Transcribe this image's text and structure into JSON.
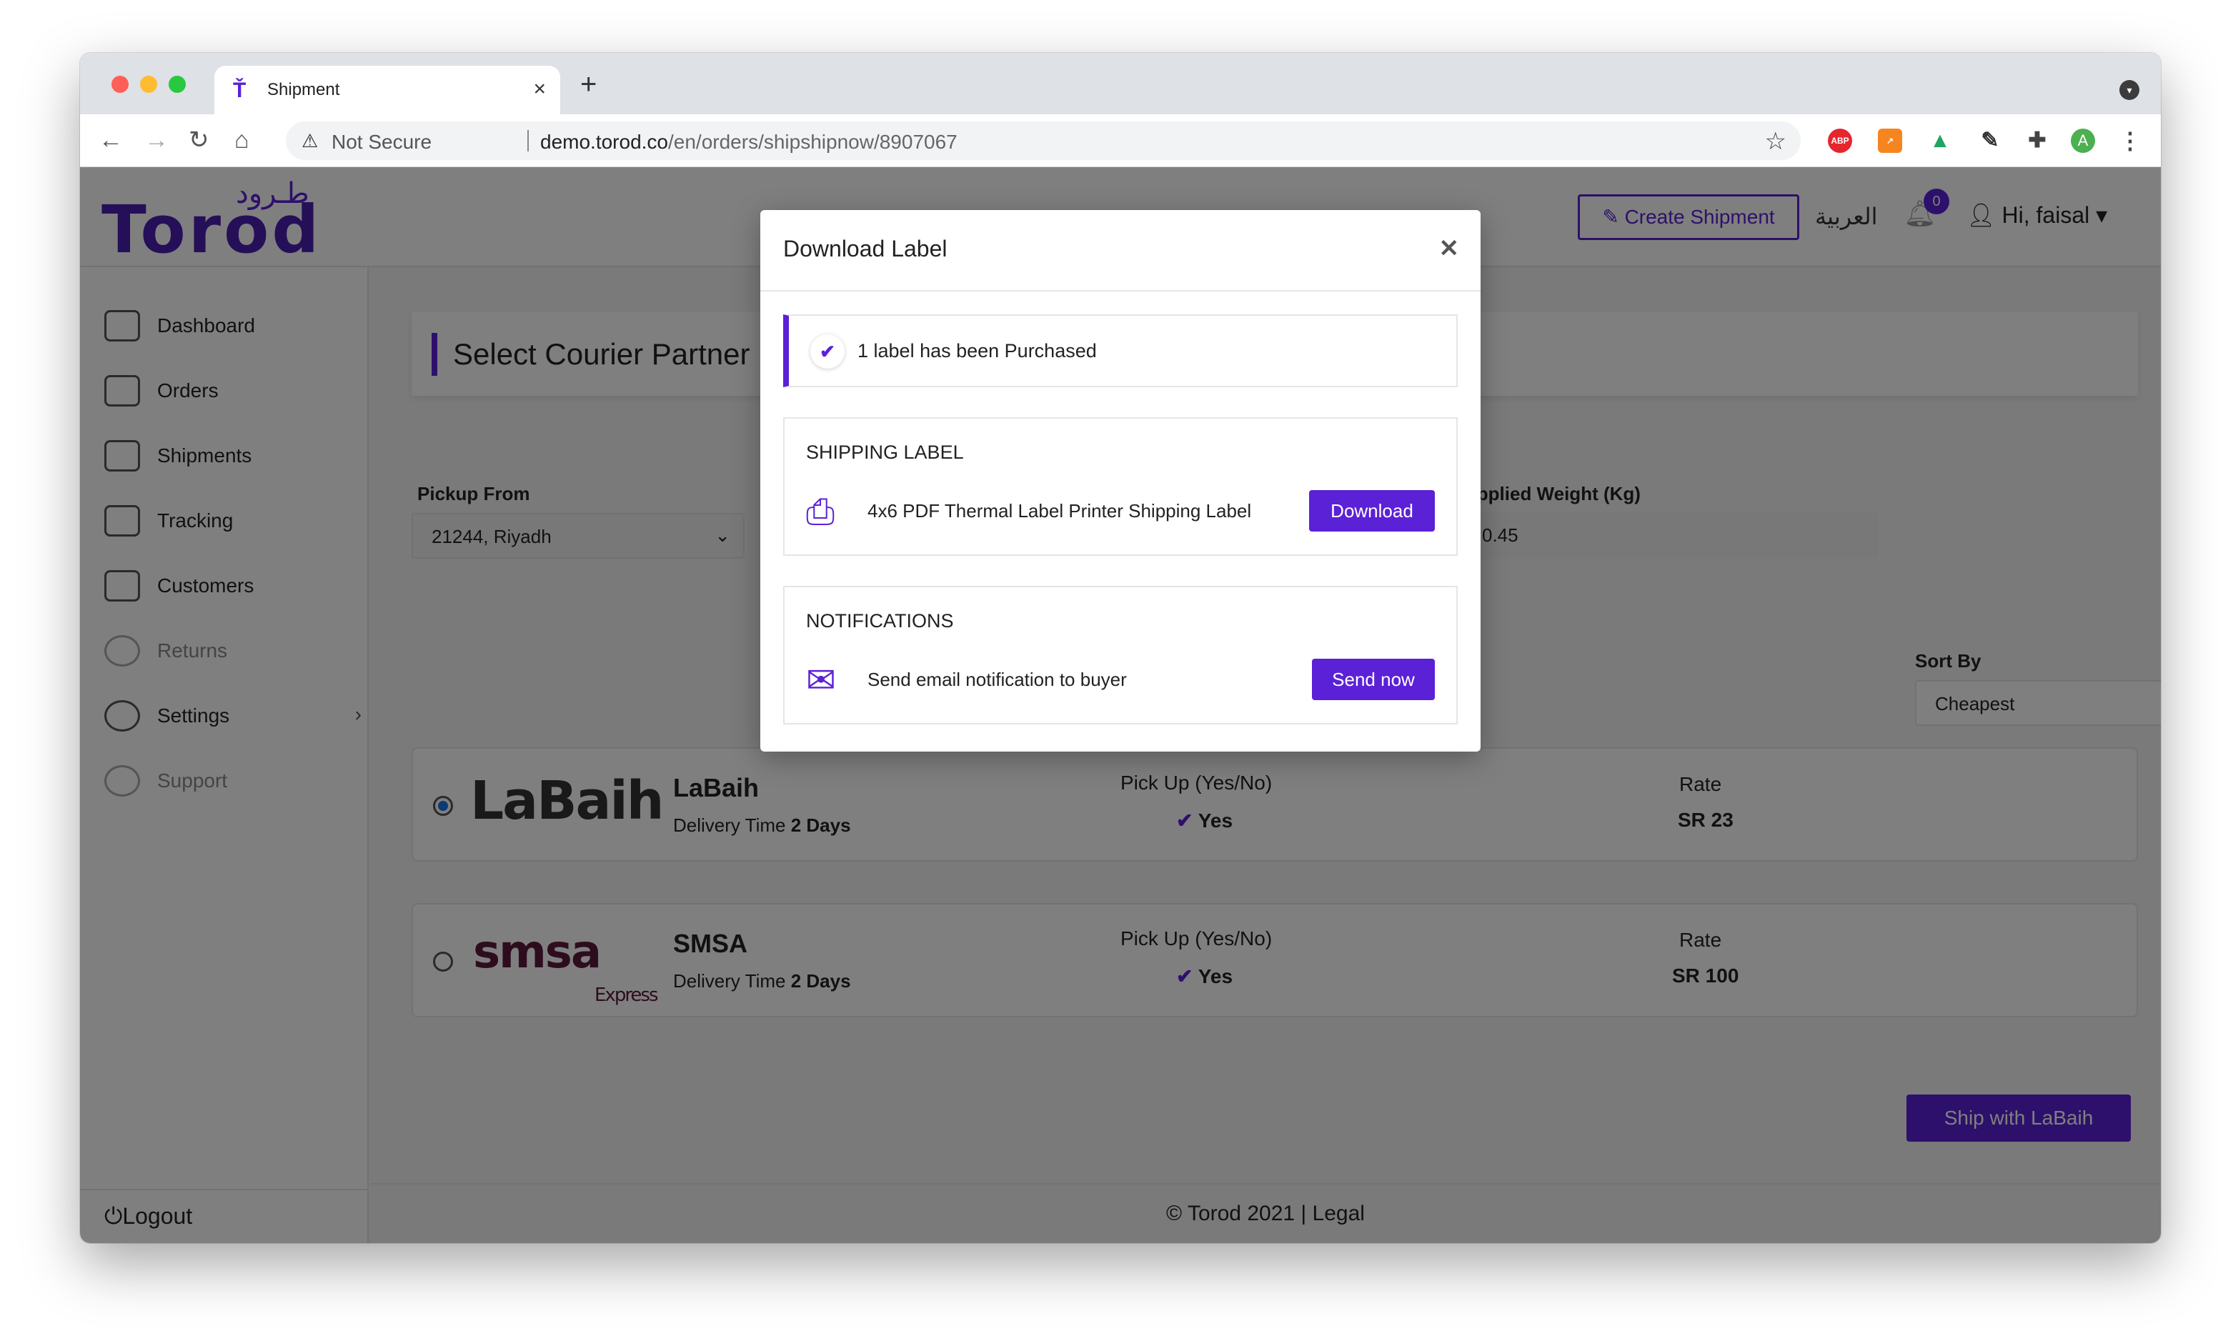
{
  "browser": {
    "tab_title": "Shipment",
    "tab_favicon": "torod-favicon",
    "security_label": "Not Secure",
    "url_domain": "demo.torod.co",
    "url_path": "/en/orders/shipshipnow/8907067",
    "profile_initial": "A",
    "ext_abp_label": "ABP"
  },
  "header": {
    "logo_ar": "طـرود",
    "logo_en": "Torod",
    "create_shipment_label": "Create Shipment",
    "language_label": "العربية",
    "notification_count": "0",
    "user_greeting": "Hi, faisal"
  },
  "sidebar": {
    "items": [
      {
        "label": "Dashboard",
        "icon": "dashboard-icon"
      },
      {
        "label": "Orders",
        "icon": "orders-icon"
      },
      {
        "label": "Shipments",
        "icon": "truck-icon"
      },
      {
        "label": "Tracking",
        "icon": "tracking-icon"
      },
      {
        "label": "Customers",
        "icon": "customers-icon"
      },
      {
        "label": "Returns",
        "icon": "returns-icon"
      },
      {
        "label": "Settings",
        "icon": "gear-icon"
      },
      {
        "label": "Support",
        "icon": "headset-icon"
      }
    ],
    "logout_label": "Logout"
  },
  "main": {
    "section_title": "Select Courier Partner",
    "pickup_label": "Pickup From",
    "pickup_value": "21244, Riyadh",
    "weight_label": "Applied Weight (Kg)",
    "weight_value": "0.45",
    "sort_label": "Sort By",
    "sort_value": "Cheapest",
    "couriers": [
      {
        "logo_text": "LaBaih",
        "name": "LaBaih",
        "delivery_prefix": "Delivery Time",
        "delivery_value": "2 Days",
        "pickup_header": "Pick Up (Yes/No)",
        "pickup_value": "Yes",
        "rate_header": "Rate",
        "rate_value": "SR 23",
        "selected": true
      },
      {
        "logo_text": "smsa",
        "logo_sub": "Express",
        "name": "SMSA",
        "delivery_prefix": "Delivery Time",
        "delivery_value": "2 Days",
        "pickup_header": "Pick Up (Yes/No)",
        "pickup_value": "Yes",
        "rate_header": "Rate",
        "rate_value": "SR 100",
        "selected": false
      }
    ],
    "ship_button_label": "Ship with LaBaih",
    "footer_text": "© Torod 2021 | Legal"
  },
  "modal": {
    "title": "Download Label",
    "alert_text": "1 label has been Purchased",
    "shipping_section_title": "SHIPPING LABEL",
    "shipping_label_text": "4x6 PDF Thermal Label Printer Shipping Label",
    "download_label": "Download",
    "notifications_section_title": "NOTIFICATIONS",
    "notification_text": "Send email notification to buyer",
    "send_now_label": "Send now"
  },
  "colors": {
    "brand": "#5b21d6",
    "overlay": "rgba(0,0,0,0.5)"
  }
}
